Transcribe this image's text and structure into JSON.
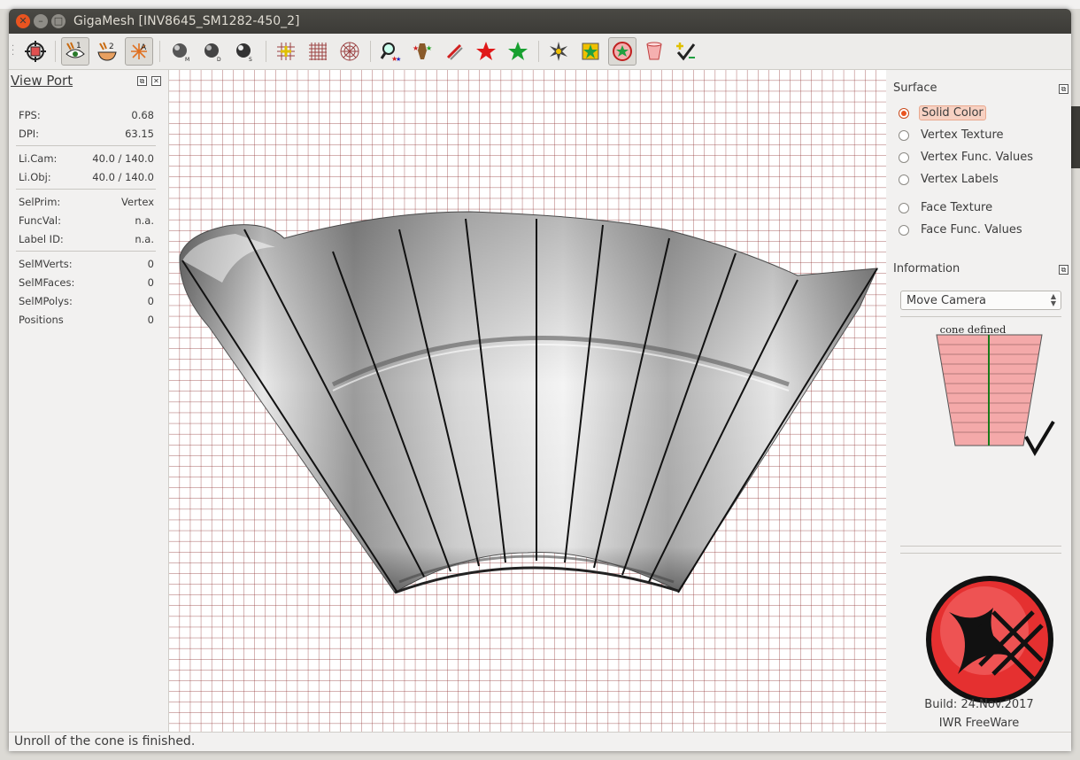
{
  "window": {
    "title": "GigaMesh [INV8645_SM1282-450_2]"
  },
  "toolbar": {
    "buttons": [
      "select-region-icon",
      "view-1-eye-icon",
      "view-2-bowl-icon",
      "light-a-icon",
      "sphere-m-icon",
      "sphere-d-icon",
      "sphere-s-icon",
      "grid-add-icon",
      "grid-icon",
      "polar-grid-icon",
      "search-stars-icon",
      "figure-stars-icon",
      "no-marker-icon",
      "red-star-icon",
      "green-star-icon",
      "burst-icon",
      "star-square-icon",
      "star-circle-icon",
      "cup-icon",
      "check-add-icon"
    ]
  },
  "viewport_panel": {
    "title": "View Port",
    "stats": [
      {
        "k": "FPS:",
        "v": "0.68"
      },
      {
        "k": "DPI:",
        "v": "63.15"
      },
      {
        "k": "Li.Cam:",
        "v": "40.0 / 140.0"
      },
      {
        "k": "Li.Obj:",
        "v": "40.0 / 140.0"
      },
      {
        "k": "SelPrim:",
        "v": "Vertex"
      },
      {
        "k": "FuncVal:",
        "v": "n.a."
      },
      {
        "k": "Label ID:",
        "v": "n.a."
      },
      {
        "k": "SelMVerts:",
        "v": "0"
      },
      {
        "k": "SelMFaces:",
        "v": "0"
      },
      {
        "k": "SelMPolys:",
        "v": "0"
      },
      {
        "k": "Positions",
        "v": "0"
      }
    ]
  },
  "surface": {
    "title": "Surface",
    "options": [
      {
        "label": "Solid Color",
        "selected": true
      },
      {
        "label": "Vertex Texture",
        "selected": false
      },
      {
        "label": "Vertex Func. Values",
        "selected": false
      },
      {
        "label": "Vertex Labels",
        "selected": false
      },
      {
        "label": "Face Texture",
        "selected": false
      },
      {
        "label": "Face Func. Values",
        "selected": false
      }
    ]
  },
  "information": {
    "title": "Information",
    "mode_select": "Move Camera",
    "cone_label": "cone defined",
    "build": "Build: 24.Nov.2017",
    "license": "IWR FreeWare"
  },
  "status": {
    "message": "Unroll of the cone is finished."
  },
  "colors": {
    "accent": "#e95420",
    "grid": "#8c2b2b",
    "titlebar": "#3c3b37"
  }
}
